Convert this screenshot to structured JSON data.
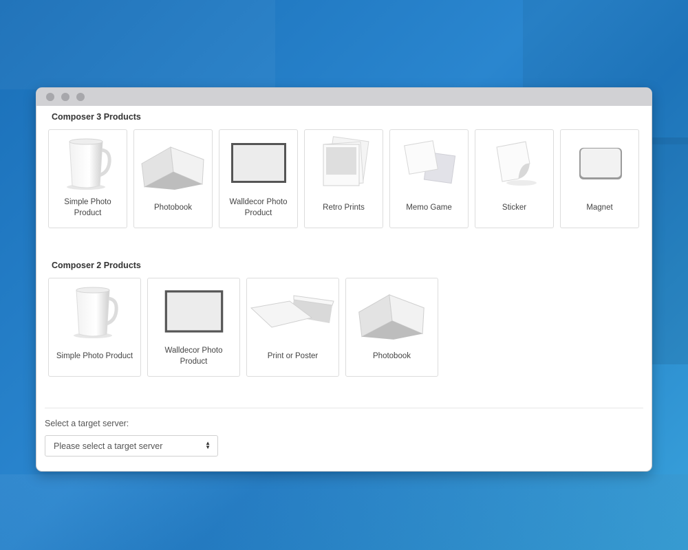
{
  "sections": [
    {
      "title": "Composer 3 Products",
      "products": [
        {
          "label": "Simple Photo Product",
          "icon": "mug-icon"
        },
        {
          "label": "Photobook",
          "icon": "photobook-icon"
        },
        {
          "label": "Walldecor Photo Product",
          "icon": "frame-icon"
        },
        {
          "label": "Retro Prints",
          "icon": "retro-prints-icon"
        },
        {
          "label": "Memo Game",
          "icon": "memo-game-icon"
        },
        {
          "label": "Sticker",
          "icon": "sticker-icon"
        },
        {
          "label": "Magnet",
          "icon": "magnet-icon"
        }
      ]
    },
    {
      "title": "Composer 2 Products",
      "products": [
        {
          "label": "Simple Photo Product",
          "icon": "mug-icon"
        },
        {
          "label": "Walldecor Photo Product",
          "icon": "frame-icon"
        },
        {
          "label": "Print or Poster",
          "icon": "print-stack-icon"
        },
        {
          "label": "Photobook",
          "icon": "photobook-icon"
        }
      ]
    }
  ],
  "server": {
    "label": "Select a target server:",
    "placeholder": "Please select a target server"
  }
}
